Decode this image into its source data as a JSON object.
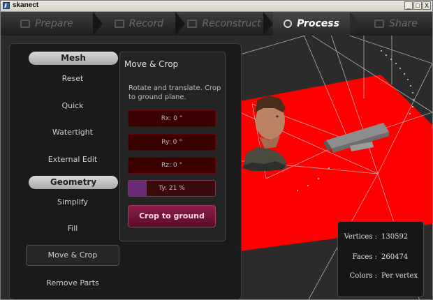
{
  "window": {
    "title": "skanect",
    "buttons": {
      "minimize": "_",
      "maximize": "□",
      "close": "X"
    }
  },
  "nav": {
    "tabs": [
      {
        "label": "Prepare",
        "icon": "person-silhouette-icon"
      },
      {
        "label": "Record",
        "icon": "film-icon"
      },
      {
        "label": "Reconstruct",
        "icon": "film-stack-icon"
      },
      {
        "label": "Process",
        "icon": "gears-icon",
        "active": true
      },
      {
        "label": "Share",
        "icon": "thumbs-up-icon"
      }
    ]
  },
  "left_menu": {
    "mesh_header": "Mesh",
    "mesh_items": [
      "Reset",
      "Quick",
      "Watertight",
      "External Edit"
    ],
    "geometry_header": "Geometry",
    "geometry_items": [
      "Simplify",
      "Fill",
      "Move & Crop",
      "Remove Parts"
    ],
    "selected": "Move & Crop"
  },
  "move_crop": {
    "title": "Move & Crop",
    "description": "Rotate and translate. Crop to ground plane.",
    "fields": {
      "rx": "Rx: 0 °",
      "ry": "Ry: 0 °",
      "rz": "Rz: 0 °",
      "ty": "Ty: 21 %"
    },
    "ty_percent": 21,
    "crop_button": "Crop to ground"
  },
  "stats": {
    "vertices_label": "Vertices :",
    "vertices_value": "130592",
    "faces_label": "Faces :",
    "faces_value": "260474",
    "colors_label": "Colors :",
    "colors_value": "Per vertex"
  },
  "colors": {
    "ground_plane": "#ff0000",
    "crop_button": "#7a1640",
    "background": "#2b2b2b"
  }
}
